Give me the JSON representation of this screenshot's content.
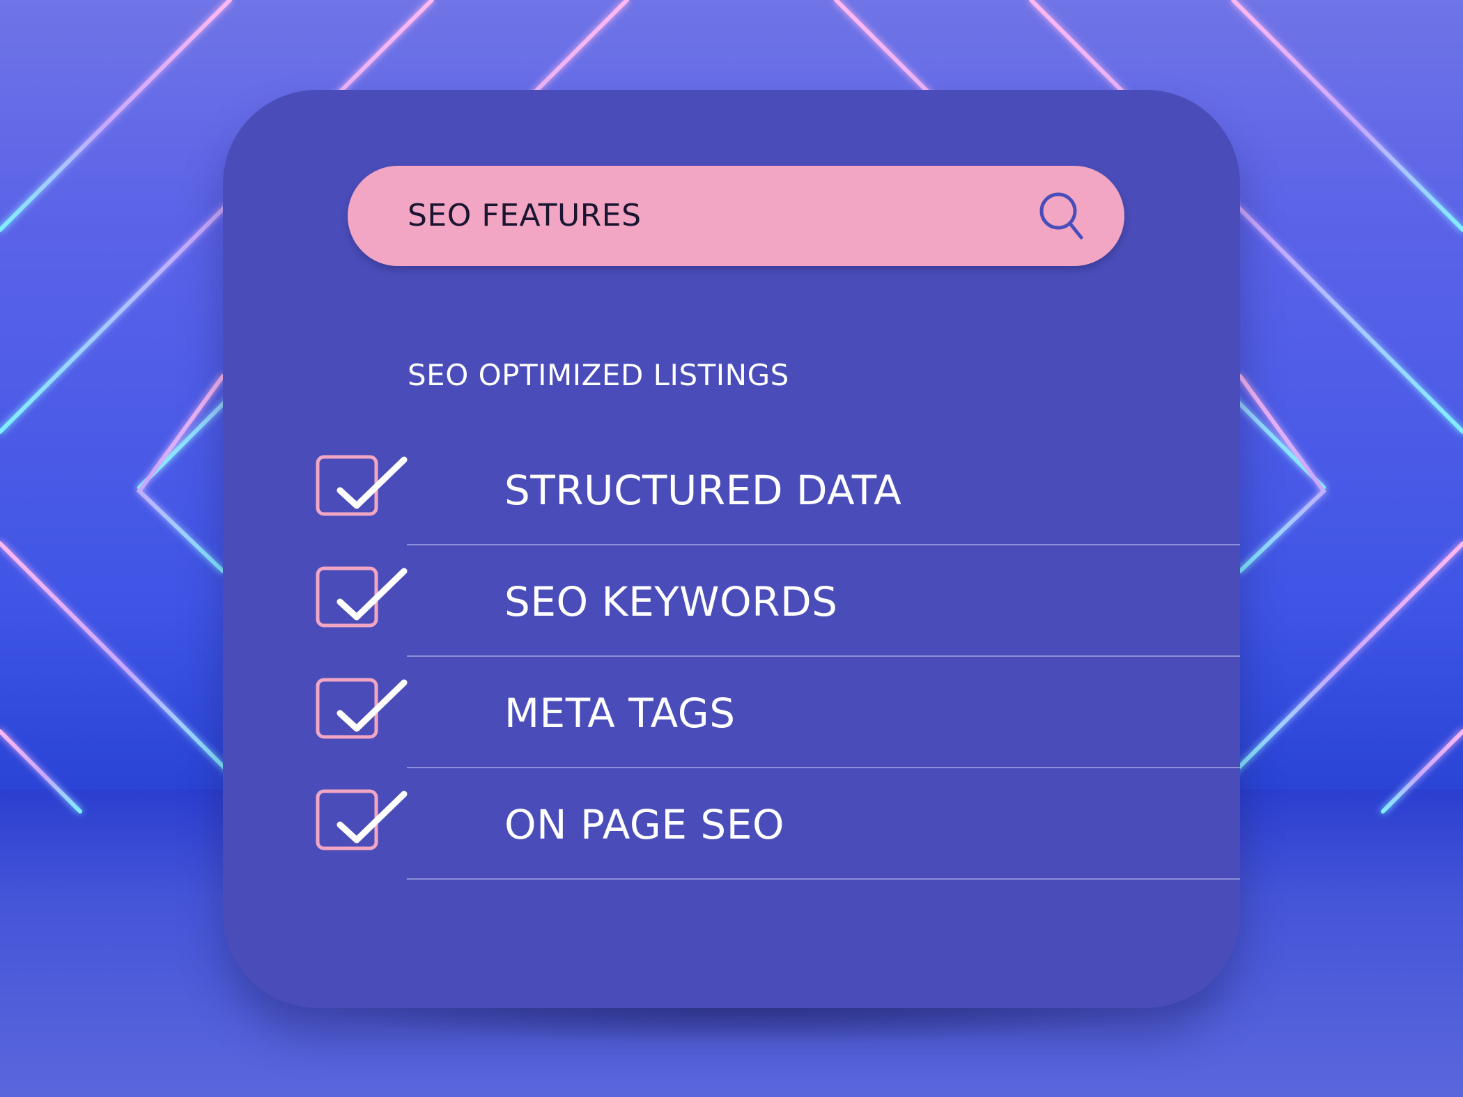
{
  "search": {
    "value": "SEO FEATURES",
    "icon": "search-icon"
  },
  "section": {
    "heading": "SEO OPTIMIZED LISTINGS"
  },
  "features": [
    {
      "label": "STRUCTURED DATA",
      "checked": true
    },
    {
      "label": "SEO KEYWORDS",
      "checked": true
    },
    {
      "label": "META TAGS",
      "checked": true
    },
    {
      "label": "ON PAGE SEO",
      "checked": true
    }
  ],
  "colors": {
    "card": "#4a4db9",
    "search_bar": "#f2a6c3",
    "checkbox_border": "#f2a6c3",
    "checkmark": "#ffffff",
    "text": "#ffffff",
    "neon_pink": "#ffb8f0",
    "neon_cyan": "#7ff0ff"
  }
}
